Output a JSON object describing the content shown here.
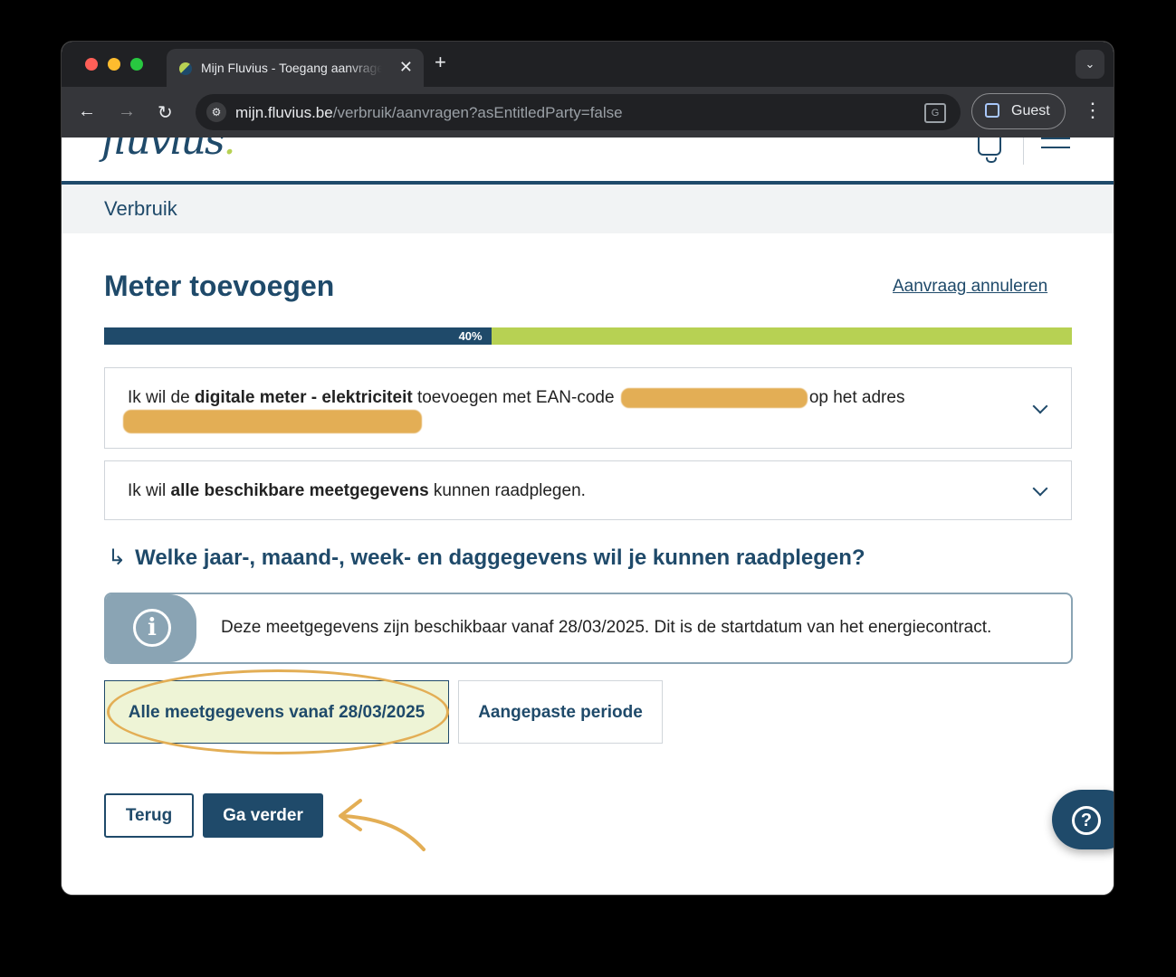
{
  "browser": {
    "tab_title": "Mijn Fluvius - Toegang aanvragen",
    "url_host": "mijn.fluvius.be",
    "url_path": "/verbruik/aanvragen?asEntitledParty=false",
    "guest_label": "Guest"
  },
  "header": {
    "logo_text": "fluvius",
    "logo_dot": "."
  },
  "subheader": {
    "title": "Verbruik"
  },
  "main": {
    "title": "Meter toevoegen",
    "cancel_link": "Aanvraag annuleren",
    "progress": {
      "percent": 40,
      "label": "40%"
    },
    "summary_card_1": {
      "prefix": "Ik wil de ",
      "bold": "digitale meter - elektriciteit",
      "middle": " toevoegen met EAN-code ",
      "suffix": "op het adres"
    },
    "summary_card_2": {
      "prefix": "Ik wil ",
      "bold": "alle beschikbare meetgegevens",
      "suffix": " kunnen raadplegen."
    },
    "question": "Welke jaar-, maand-, week- en daggegevens wil je kunnen raadplegen?",
    "info_text": "Deze meetgegevens zijn beschikbaar vanaf 28/03/2025. Dit is de startdatum van het energiecontract.",
    "options": [
      {
        "label": "Alle meetgegevens vanaf 28/03/2025",
        "selected": true
      },
      {
        "label": "Aangepaste periode",
        "selected": false
      }
    ],
    "back_button": "Terug",
    "next_button": "Ga verder"
  },
  "colors": {
    "brand": "#1f4a6a",
    "accent": "#b7d153",
    "annotation": "#e3ae55"
  }
}
